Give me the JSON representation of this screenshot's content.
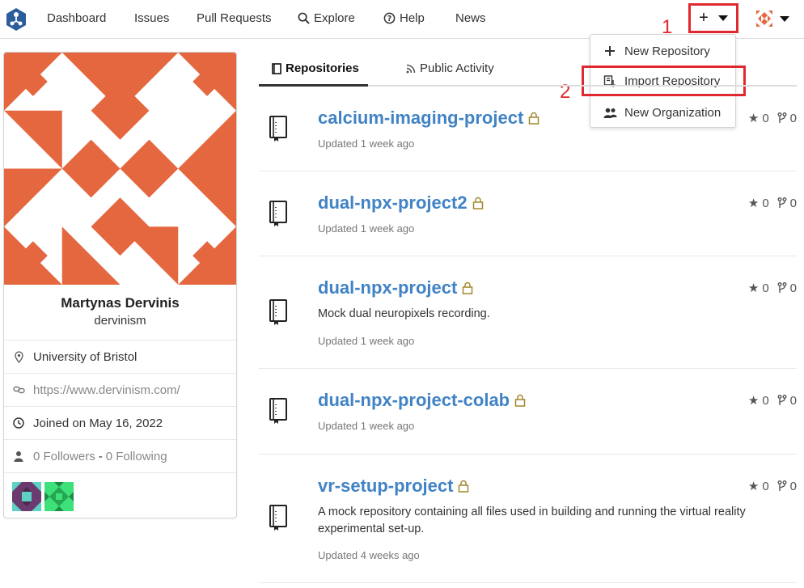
{
  "nav": {
    "items": [
      "Dashboard",
      "Issues",
      "Pull Requests",
      "Explore",
      "Help",
      "News"
    ],
    "plus_symbol": "+",
    "annotation_1": "1",
    "annotation_2": "2"
  },
  "dropdown": {
    "items": [
      {
        "label": "New Repository",
        "icon": "plus-icon"
      },
      {
        "label": "Import Repository",
        "icon": "import-icon"
      },
      {
        "label": "New Organization",
        "icon": "organization-icon"
      }
    ]
  },
  "profile": {
    "full_name": "Martynas Dervinis",
    "username": "dervinism",
    "location": "University of Bristol",
    "website": "https://www.dervinism.com/",
    "joined": "Joined on May 16, 2022",
    "followers": "0 Followers",
    "separator": "-",
    "following": "0 Following",
    "accent_color": "#e4673f"
  },
  "tabs": [
    {
      "label": "Repositories",
      "active": true
    },
    {
      "label": "Public Activity",
      "active": false
    }
  ],
  "repos": [
    {
      "name": "calcium-imaging-project",
      "description": "",
      "updated": "Updated 1 week ago",
      "stars": "0",
      "forks": "0"
    },
    {
      "name": "dual-npx-project2",
      "description": "",
      "updated": "Updated 1 week ago",
      "stars": "0",
      "forks": "0"
    },
    {
      "name": "dual-npx-project",
      "description": "Mock dual neuropixels recording.",
      "updated": "Updated 1 week ago",
      "stars": "0",
      "forks": "0"
    },
    {
      "name": "dual-npx-project-colab",
      "description": "",
      "updated": "Updated 1 week ago",
      "stars": "0",
      "forks": "0"
    },
    {
      "name": "vr-setup-project",
      "description": "A mock repository containing all files used in building and running the virtual reality experimental set-up.",
      "updated": "Updated 4 weeks ago",
      "stars": "0",
      "forks": "0"
    }
  ],
  "colors": {
    "link": "#4183c4",
    "annotation": "#e0282e",
    "lock": "#a1882b"
  }
}
